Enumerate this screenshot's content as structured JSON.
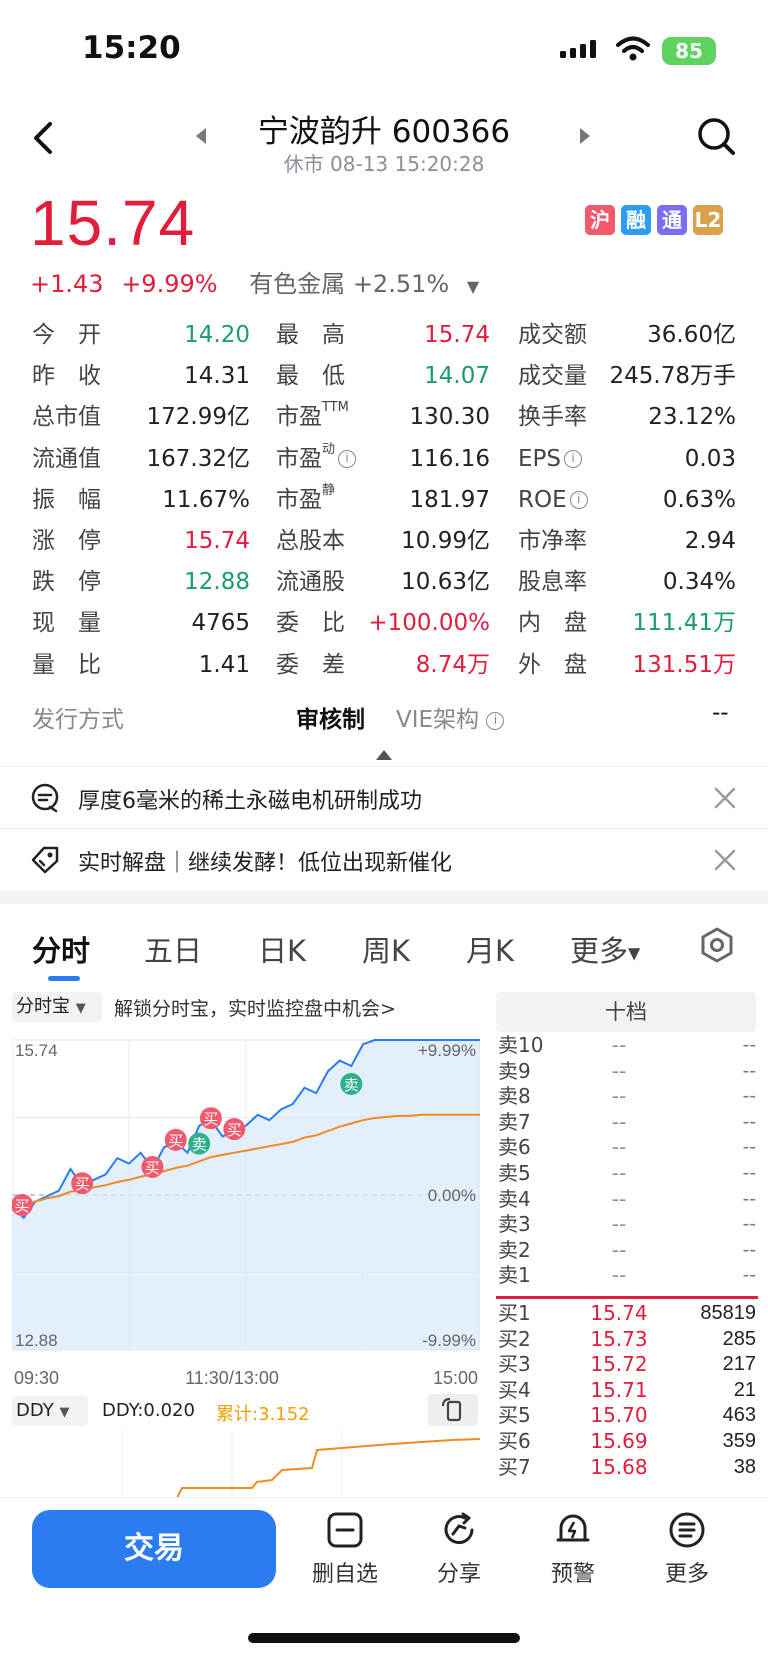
{
  "status": {
    "time": "15:20",
    "battery": "85"
  },
  "header": {
    "title": "宁波韵升 600366",
    "subtitle": "休市 08-13 15:20:28"
  },
  "quote": {
    "price": "15.74",
    "change": "+1.43",
    "change_pct": "+9.99%",
    "sector": "有色金属 +2.51%",
    "badges": [
      {
        "text": "沪",
        "color": "#f05a6c"
      },
      {
        "text": "融",
        "color": "#2e9cf3"
      },
      {
        "text": "通",
        "color": "#7a6cf5"
      },
      {
        "text": "L2",
        "color": "#d9a14a"
      }
    ]
  },
  "stats": {
    "rows": [
      [
        {
          "l": "今　开",
          "v": "14.20",
          "c": "green"
        },
        {
          "l": "最　高",
          "v": "15.74",
          "c": "red"
        },
        {
          "l": "成交额",
          "v": "36.60亿",
          "c": ""
        }
      ],
      [
        {
          "l": "昨　收",
          "v": "14.31",
          "c": ""
        },
        {
          "l": "最　低",
          "v": "14.07",
          "c": "green"
        },
        {
          "l": "成交量",
          "v": "245.78万手",
          "c": ""
        }
      ],
      [
        {
          "l": "总市值",
          "v": "172.99亿",
          "c": ""
        },
        {
          "l": "市盈",
          "sup": "TTM",
          "v": "130.30",
          "c": ""
        },
        {
          "l": "换手率",
          "v": "23.12%",
          "c": ""
        }
      ],
      [
        {
          "l": "流通值",
          "v": "167.32亿",
          "c": ""
        },
        {
          "l": "市盈",
          "sup": "动",
          "info": true,
          "v": "116.16",
          "c": ""
        },
        {
          "l": "EPS",
          "info": true,
          "v": "0.03",
          "c": ""
        }
      ],
      [
        {
          "l": "振　幅",
          "v": "11.67%",
          "c": ""
        },
        {
          "l": "市盈",
          "sup": "静",
          "v": "181.97",
          "c": ""
        },
        {
          "l": "ROE",
          "info": true,
          "v": "0.63%",
          "c": ""
        }
      ],
      [
        {
          "l": "涨　停",
          "v": "15.74",
          "c": "red"
        },
        {
          "l": "总股本",
          "v": "10.99亿",
          "c": ""
        },
        {
          "l": "市净率",
          "v": "2.94",
          "c": ""
        }
      ],
      [
        {
          "l": "跌　停",
          "v": "12.88",
          "c": "green"
        },
        {
          "l": "流通股",
          "v": "10.63亿",
          "c": ""
        },
        {
          "l": "股息率",
          "v": "0.34%",
          "c": ""
        }
      ],
      [
        {
          "l": "现　量",
          "v": "4765",
          "c": ""
        },
        {
          "l": "委　比",
          "v": "+100.00%",
          "c": "red"
        },
        {
          "l": "内　盘",
          "v": "111.41万",
          "c": "green"
        }
      ],
      [
        {
          "l": "量　比",
          "v": "1.41",
          "c": ""
        },
        {
          "l": "委　差",
          "v": "8.74万",
          "c": "red"
        },
        {
          "l": "外　盘",
          "v": "131.51万",
          "c": "red"
        }
      ]
    ]
  },
  "issue": {
    "label": "发行方式",
    "value": "审核制",
    "vie_label": "VIE架构",
    "vie_value": "--"
  },
  "news": [
    {
      "text": "厚度6毫米的稀土永磁电机研制成功"
    },
    {
      "text": "实时解盘｜继续发酵！低位出现新催化"
    }
  ],
  "tabs": [
    "分时",
    "五日",
    "日K",
    "周K",
    "月K",
    "更多"
  ],
  "chart": {
    "tool_chip": "分时宝",
    "unlock_text": "解锁分时宝，实时监控盘中机会>",
    "y_top": "15.74",
    "y_bottom": "12.88",
    "pct_top": "+9.99%",
    "pct_mid": "0.00%",
    "pct_bottom": "-9.99%",
    "x_start": "09:30",
    "x_mid": "11:30/13:00",
    "x_end": "15:00",
    "mark_buy": "买",
    "mark_sell": "卖"
  },
  "chart_data": {
    "type": "line",
    "ylim": [
      12.88,
      15.74
    ],
    "series": [
      {
        "values": [
          14.2,
          14.1,
          14.25,
          14.3,
          14.35,
          14.55,
          14.4,
          14.45,
          14.5,
          14.65,
          14.6,
          14.7,
          14.55,
          14.75,
          14.8,
          14.7,
          14.95,
          15.0,
          14.85,
          14.9,
          14.95,
          15.05,
          15.0,
          15.1,
          15.15,
          15.3,
          15.25,
          15.45,
          15.55,
          15.5,
          15.7,
          15.74,
          15.74,
          15.74,
          15.74,
          15.74,
          15.74,
          15.74,
          15.74,
          15.74,
          15.74
        ]
      },
      {
        "values": [
          14.2,
          14.22,
          14.25,
          14.28,
          14.3,
          14.34,
          14.36,
          14.38,
          14.4,
          14.43,
          14.45,
          14.48,
          14.5,
          14.53,
          14.56,
          14.58,
          14.62,
          14.66,
          14.68,
          14.7,
          14.72,
          14.74,
          14.76,
          14.78,
          14.8,
          14.84,
          14.86,
          14.9,
          14.94,
          14.97,
          15.0,
          15.02,
          15.03,
          15.04,
          15.04,
          15.05,
          15.05,
          15.05,
          15.05,
          15.05,
          15.05
        ]
      }
    ]
  },
  "ddy": {
    "label": "DDY",
    "value": "DDY:0.020",
    "total": "累计:3.152"
  },
  "order_book": {
    "title": "十档",
    "sell": [
      {
        "l": "卖10",
        "p": "--",
        "v": "--"
      },
      {
        "l": "卖9",
        "p": "--",
        "v": "--"
      },
      {
        "l": "卖8",
        "p": "--",
        "v": "--"
      },
      {
        "l": "卖7",
        "p": "--",
        "v": "--"
      },
      {
        "l": "卖6",
        "p": "--",
        "v": "--"
      },
      {
        "l": "卖5",
        "p": "--",
        "v": "--"
      },
      {
        "l": "卖4",
        "p": "--",
        "v": "--"
      },
      {
        "l": "卖3",
        "p": "--",
        "v": "--"
      },
      {
        "l": "卖2",
        "p": "--",
        "v": "--"
      },
      {
        "l": "卖1",
        "p": "--",
        "v": "--"
      }
    ],
    "buy": [
      {
        "l": "买1",
        "p": "15.74",
        "v": "85819"
      },
      {
        "l": "买2",
        "p": "15.73",
        "v": "285"
      },
      {
        "l": "买3",
        "p": "15.72",
        "v": "217"
      },
      {
        "l": "买4",
        "p": "15.71",
        "v": "21"
      },
      {
        "l": "买5",
        "p": "15.70",
        "v": "463"
      },
      {
        "l": "买6",
        "p": "15.69",
        "v": "359"
      },
      {
        "l": "买7",
        "p": "15.68",
        "v": "38"
      }
    ]
  },
  "bottom": {
    "trade": "交易",
    "items": [
      "删自选",
      "分享",
      "预警",
      "更多"
    ]
  }
}
